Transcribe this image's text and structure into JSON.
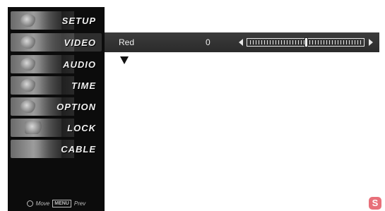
{
  "menu": {
    "items": [
      {
        "label": "SETUP",
        "selected": false
      },
      {
        "label": "VIDEO",
        "selected": true
      },
      {
        "label": "AUDIO",
        "selected": false
      },
      {
        "label": "TIME",
        "selected": false
      },
      {
        "label": "OPTION",
        "selected": false
      },
      {
        "label": "LOCK",
        "selected": false
      },
      {
        "label": "CABLE",
        "selected": false
      }
    ],
    "footer": {
      "move_label": "Move",
      "menu_key": "MENU",
      "prev_label": "Prev"
    }
  },
  "setting": {
    "name": "Red",
    "value": "0",
    "slider_position": 0.5
  },
  "corner_logo": "S",
  "colors": {
    "menu_background": "#0c0c0c",
    "panel_background": "#2b2b2b",
    "text": "#eeeeee",
    "logo": "#e8707a"
  },
  "icons": [
    "left-arrow-icon",
    "right-arrow-icon",
    "down-arrow-icon",
    "navigation-button-icon"
  ]
}
